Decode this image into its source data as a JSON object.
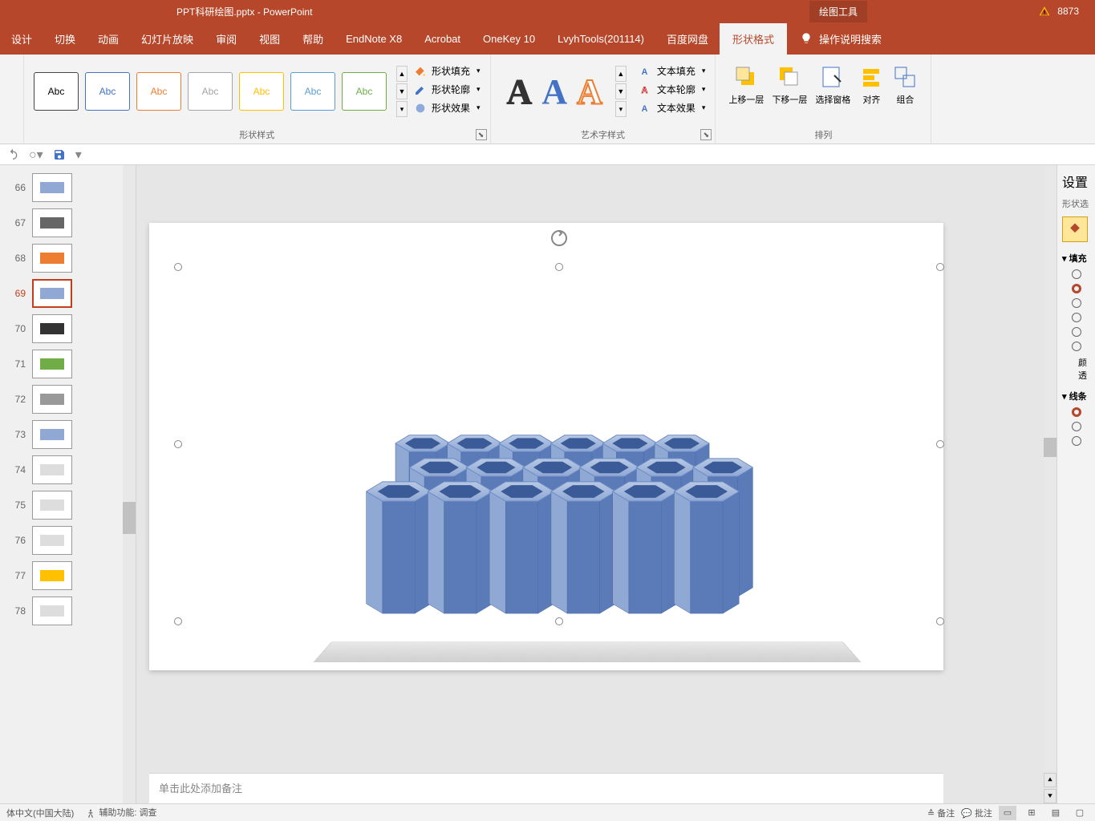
{
  "title": {
    "filename": "PPT科研绘图.pptx",
    "app": "PowerPoint",
    "separator": " - "
  },
  "title_tools": {
    "drawing_tools": "绘图工具"
  },
  "title_right": {
    "count": "8873"
  },
  "tabs": {
    "design": "设计",
    "transition": "切换",
    "animation": "动画",
    "slideshow": "幻灯片放映",
    "review": "审阅",
    "view": "视图",
    "help": "帮助",
    "endnote": "EndNote X8",
    "acrobat": "Acrobat",
    "onekey": "OneKey 10",
    "lvyh": "LvyhTools(201114)",
    "baidu": "百度网盘",
    "format": "形状格式",
    "tellme": "操作说明搜索"
  },
  "ribbon": {
    "style_label": "Abc",
    "shape_styles": "形状样式",
    "shape_fill": "形状填充",
    "shape_outline": "形状轮廓",
    "shape_effects": "形状效果",
    "wordart_styles": "艺术字样式",
    "text_fill": "文本填充",
    "text_outline": "文本轮廓",
    "text_effects": "文本效果",
    "bring_forward": "上移一层",
    "send_backward": "下移一层",
    "selection_pane": "选择窗格",
    "align": "对齐",
    "group": "组合",
    "arrange": "排列"
  },
  "slides": [
    {
      "num": "66"
    },
    {
      "num": "67"
    },
    {
      "num": "68"
    },
    {
      "num": "69",
      "active": true
    },
    {
      "num": "70"
    },
    {
      "num": "71"
    },
    {
      "num": "72"
    },
    {
      "num": "73"
    },
    {
      "num": "74"
    },
    {
      "num": "75"
    },
    {
      "num": "76"
    },
    {
      "num": "77"
    },
    {
      "num": "78"
    }
  ],
  "notes_placeholder": "单击此处添加备注",
  "right_pane": {
    "title": "设置",
    "tab": "形状选",
    "fill_section": "填充",
    "line_section": "线条",
    "color_label": "颜",
    "trans_label": "透"
  },
  "status": {
    "lang": "体中文(中国大陆)",
    "accessibility": "辅助功能: 调查",
    "notes": "备注",
    "comments": "批注"
  }
}
